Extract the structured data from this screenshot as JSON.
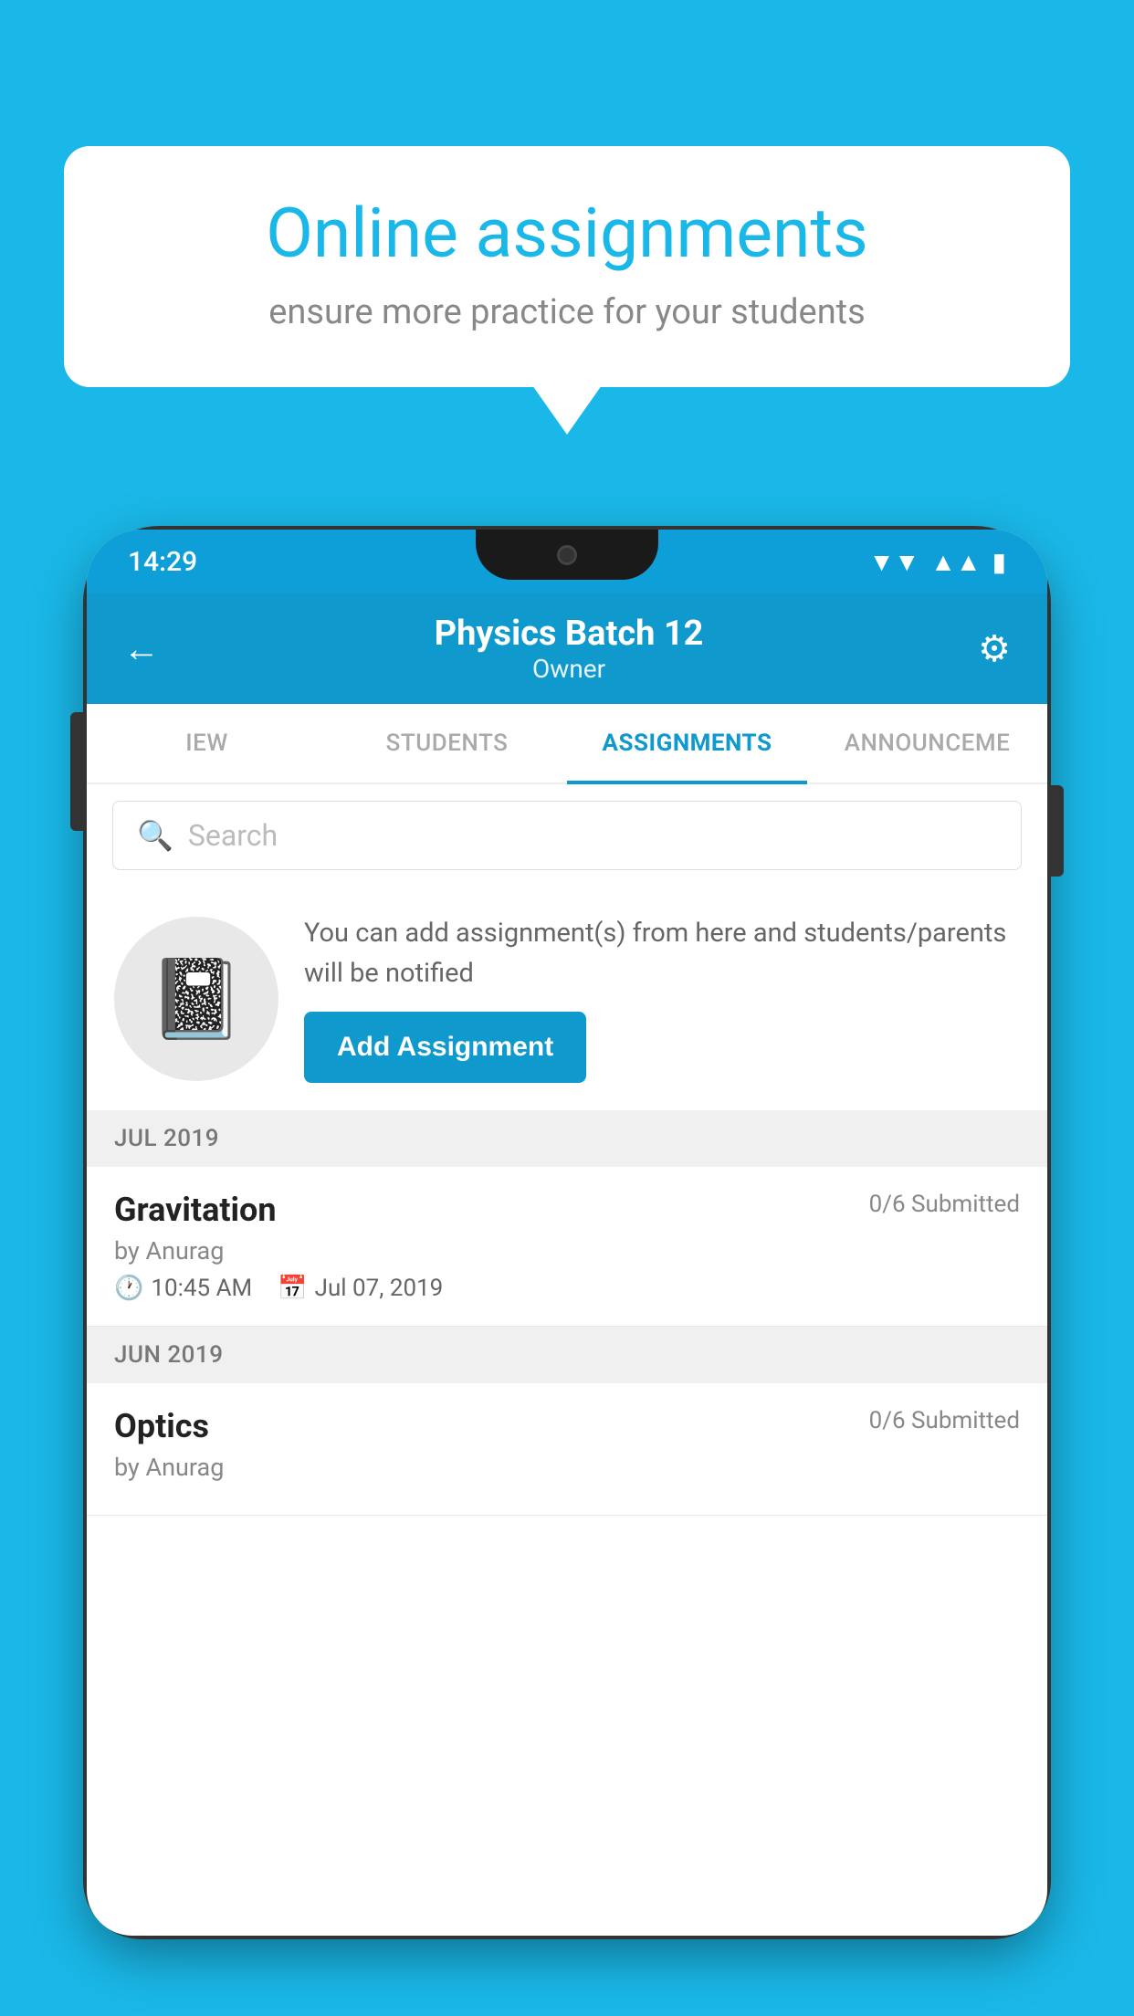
{
  "background_color": "#1ab8e8",
  "speech_bubble": {
    "title": "Online assignments",
    "subtitle": "ensure more practice for your students"
  },
  "status_bar": {
    "time": "14:29",
    "wifi_icon": "▼",
    "signal_icon": "▲",
    "battery_icon": "▮"
  },
  "header": {
    "title": "Physics Batch 12",
    "subtitle": "Owner",
    "back_icon": "←",
    "settings_icon": "⚙"
  },
  "tabs": [
    {
      "label": "IEW",
      "active": false
    },
    {
      "label": "STUDENTS",
      "active": false
    },
    {
      "label": "ASSIGNMENTS",
      "active": true
    },
    {
      "label": "ANNOUNCEME",
      "active": false
    }
  ],
  "search": {
    "placeholder": "Search"
  },
  "promo": {
    "text": "You can add assignment(s) from here and students/parents will be notified",
    "button_label": "Add Assignment"
  },
  "sections": [
    {
      "month_label": "JUL 2019",
      "assignments": [
        {
          "title": "Gravitation",
          "submitted": "0/6 Submitted",
          "author": "by Anurag",
          "time": "10:45 AM",
          "date": "Jul 07, 2019"
        }
      ]
    },
    {
      "month_label": "JUN 2019",
      "assignments": [
        {
          "title": "Optics",
          "submitted": "0/6 Submitted",
          "author": "by Anurag",
          "time": "",
          "date": ""
        }
      ]
    }
  ]
}
